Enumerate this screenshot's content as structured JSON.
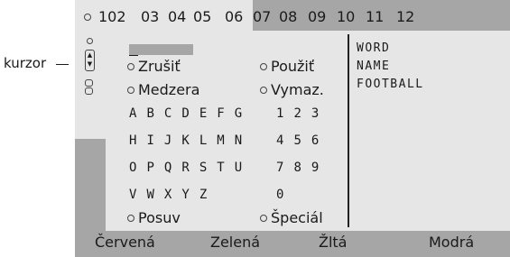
{
  "annotation": {
    "cursor_label": "kurzor"
  },
  "pages": [
    "102",
    "03",
    "04",
    "05",
    "06",
    "07",
    "08",
    "09",
    "10",
    "11",
    "12"
  ],
  "editor": {
    "options": {
      "cancel": "Zrušiť",
      "use": "Použiť",
      "space": "Medzera",
      "delete": "Vymaz.",
      "shift": "Posuv",
      "special": "Špeciál"
    },
    "keyboard_rows": [
      "A B C D E F G",
      "H I J K L M N",
      "O P Q R S T U",
      "V W X Y Z"
    ],
    "digit_rows": [
      "1 2 3",
      "4 5 6",
      "7 8 9",
      "0"
    ]
  },
  "history": [
    "WORD",
    "NAME",
    "FOOTBALL"
  ],
  "color_keys": {
    "red": "Červená",
    "green": "Zelená",
    "yellow": "Žltá",
    "blue": "Modrá"
  },
  "colors": {
    "panel": "#e6e6e6",
    "background": "#a6a6a6",
    "text": "#1a1a1a"
  }
}
